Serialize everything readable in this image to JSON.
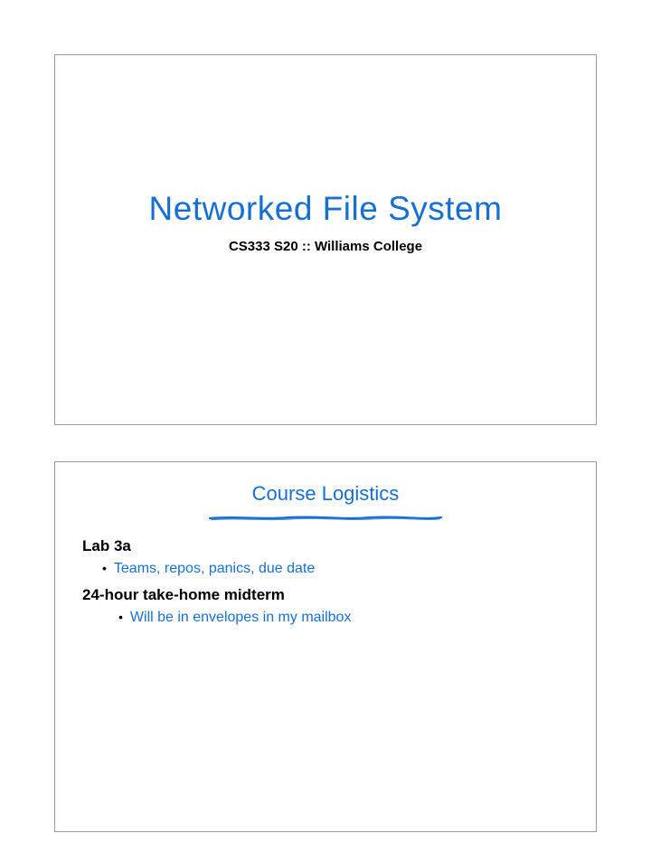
{
  "slide1": {
    "title": "Networked File System",
    "subtitle": "CS333 S20 :: Williams College"
  },
  "slide2": {
    "title": "Course Logistics",
    "sections": [
      {
        "heading": "Lab 3a",
        "bullets": [
          "Teams, repos, panics, due date"
        ]
      },
      {
        "heading": "24-hour take-home midterm",
        "bullets": [
          "Will be in envelopes in my mailbox"
        ]
      }
    ]
  }
}
